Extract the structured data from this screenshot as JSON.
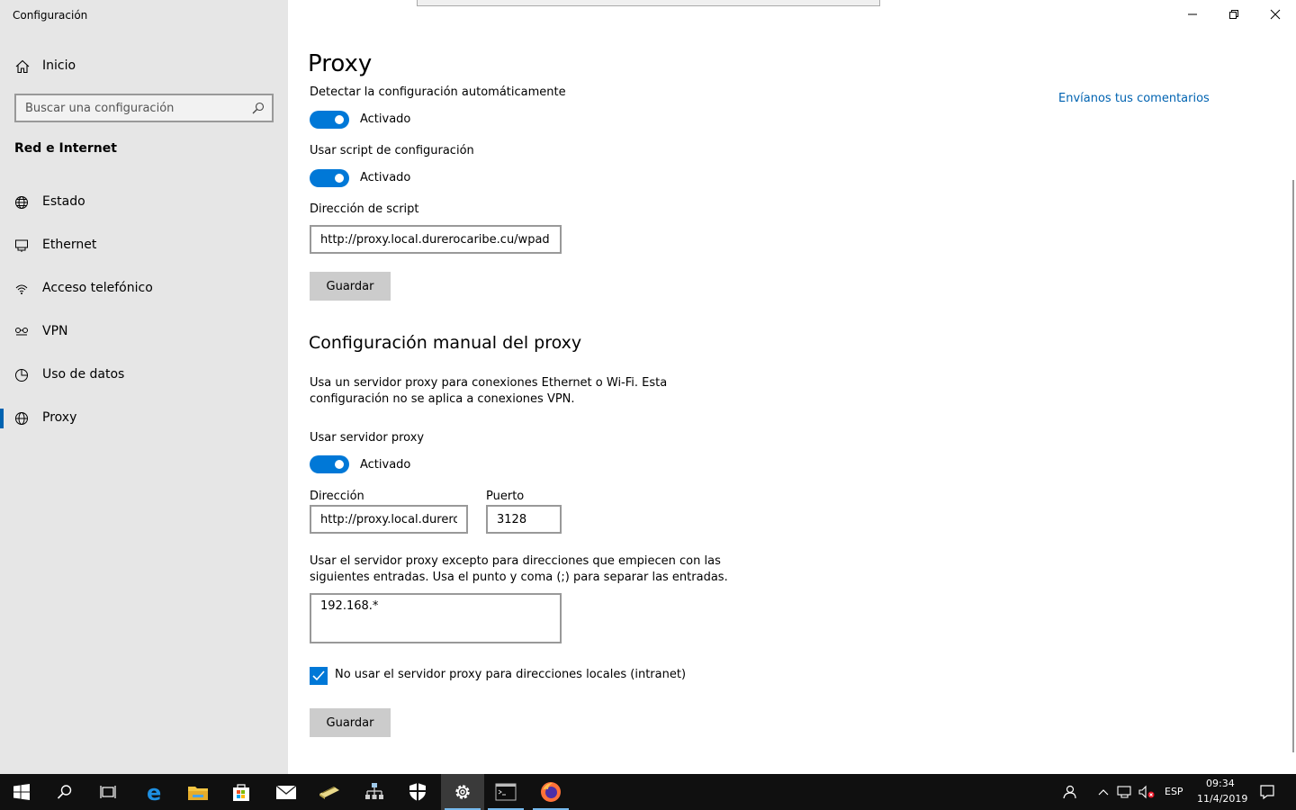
{
  "window": {
    "app_title": "Configuración"
  },
  "sidebar": {
    "home_label": "Inicio",
    "search_placeholder": "Buscar una configuración",
    "section_title": "Red e Internet",
    "items": [
      {
        "label": "Estado",
        "icon": "globe-status-icon"
      },
      {
        "label": "Ethernet",
        "icon": "ethernet-icon"
      },
      {
        "label": "Acceso telefónico",
        "icon": "dialup-icon"
      },
      {
        "label": "VPN",
        "icon": "vpn-icon"
      },
      {
        "label": "Uso de datos",
        "icon": "data-usage-icon"
      },
      {
        "label": "Proxy",
        "icon": "globe-icon",
        "active": true
      }
    ]
  },
  "main": {
    "title": "Proxy",
    "feedback_link": "Envíanos tus comentarios",
    "auto_detect_label": "Detectar la configuración automáticamente",
    "auto_detect_state": "Activado",
    "use_script_label": "Usar script de configuración",
    "use_script_state": "Activado",
    "script_address_label": "Dirección de script",
    "script_address_value": "http://proxy.local.durerocaribe.cu/wpad.dat",
    "save_label_1": "Guardar",
    "manual_heading": "Configuración manual del proxy",
    "manual_desc_line1": "Usa un servidor proxy para conexiones Ethernet o Wi-Fi. Esta",
    "manual_desc_line2": "configuración no se aplica a conexiones VPN.",
    "use_proxy_label": "Usar servidor proxy",
    "use_proxy_state": "Activado",
    "address_label": "Dirección",
    "address_value": "http://proxy.local.durerocaribe.cu",
    "port_label": "Puerto",
    "port_value": "3128",
    "exceptions_line1": "Usar el servidor proxy excepto para direcciones que empiecen con las",
    "exceptions_line2": "siguientes entradas. Usa el punto y coma (;) para separar las entradas.",
    "exceptions_value": "192.168.*",
    "local_bypass_label": "No usar el servidor proxy para direcciones locales (intranet)",
    "local_bypass_checked": true,
    "save_label_2": "Guardar"
  },
  "taskbar": {
    "language": "ESP",
    "time": "09:34",
    "date": "11/4/2019"
  },
  "colors": {
    "accent": "#0078d7",
    "link": "#0063b1",
    "sidebar_bg": "#e6e6e6",
    "taskbar_bg": "#101010"
  }
}
